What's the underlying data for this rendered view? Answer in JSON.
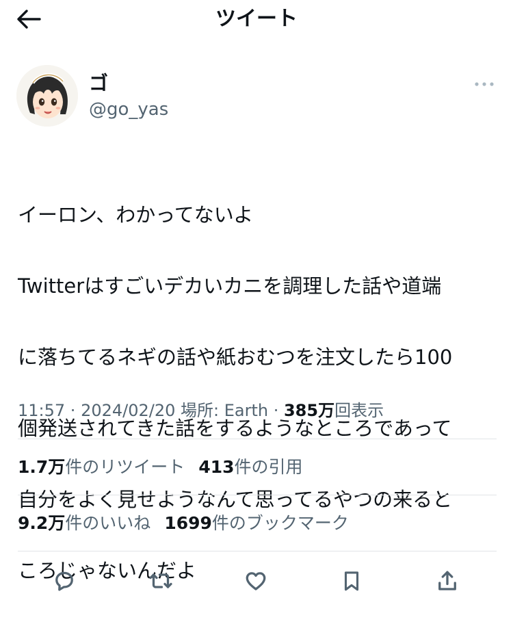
{
  "header": {
    "title": "ツイート"
  },
  "author": {
    "display_name": "ゴ",
    "handle": "@go_yas"
  },
  "tweet": {
    "lines": [
      "イーロン、わかってないよ",
      "Twitterはすごいデカいカニを調理した話や道端",
      "に落ちてるネギの話や紙おむつを注文したら100",
      "個発送されてきた話をするようなところであって",
      "自分をよく見せようなんて思ってるやつの来ると",
      "ころじゃないんだよ"
    ]
  },
  "meta": {
    "time": "11:57",
    "sep1": " · ",
    "date": "2024/02/20",
    "location": " 場所: Earth",
    "sep2": " · ",
    "views_count": "385万",
    "views_label": "回表示"
  },
  "stats": {
    "retweets_count": "1.7万",
    "retweets_label": "件のリツイート",
    "quotes_count": "413",
    "quotes_label": "件の引用",
    "likes_count": "9.2万",
    "likes_label": "件のいいね",
    "bookmarks_count": "1699",
    "bookmarks_label": "件のブックマーク"
  },
  "icons": {
    "back": "arrow-left-icon",
    "more": "more-horizontal-icon",
    "reply": "reply-icon",
    "retweet": "retweet-icon",
    "like": "heart-icon",
    "bookmark": "bookmark-icon",
    "share": "share-icon"
  },
  "colors": {
    "text_primary": "#0f1419",
    "text_secondary": "#536471",
    "divider": "#e1e4e7"
  }
}
